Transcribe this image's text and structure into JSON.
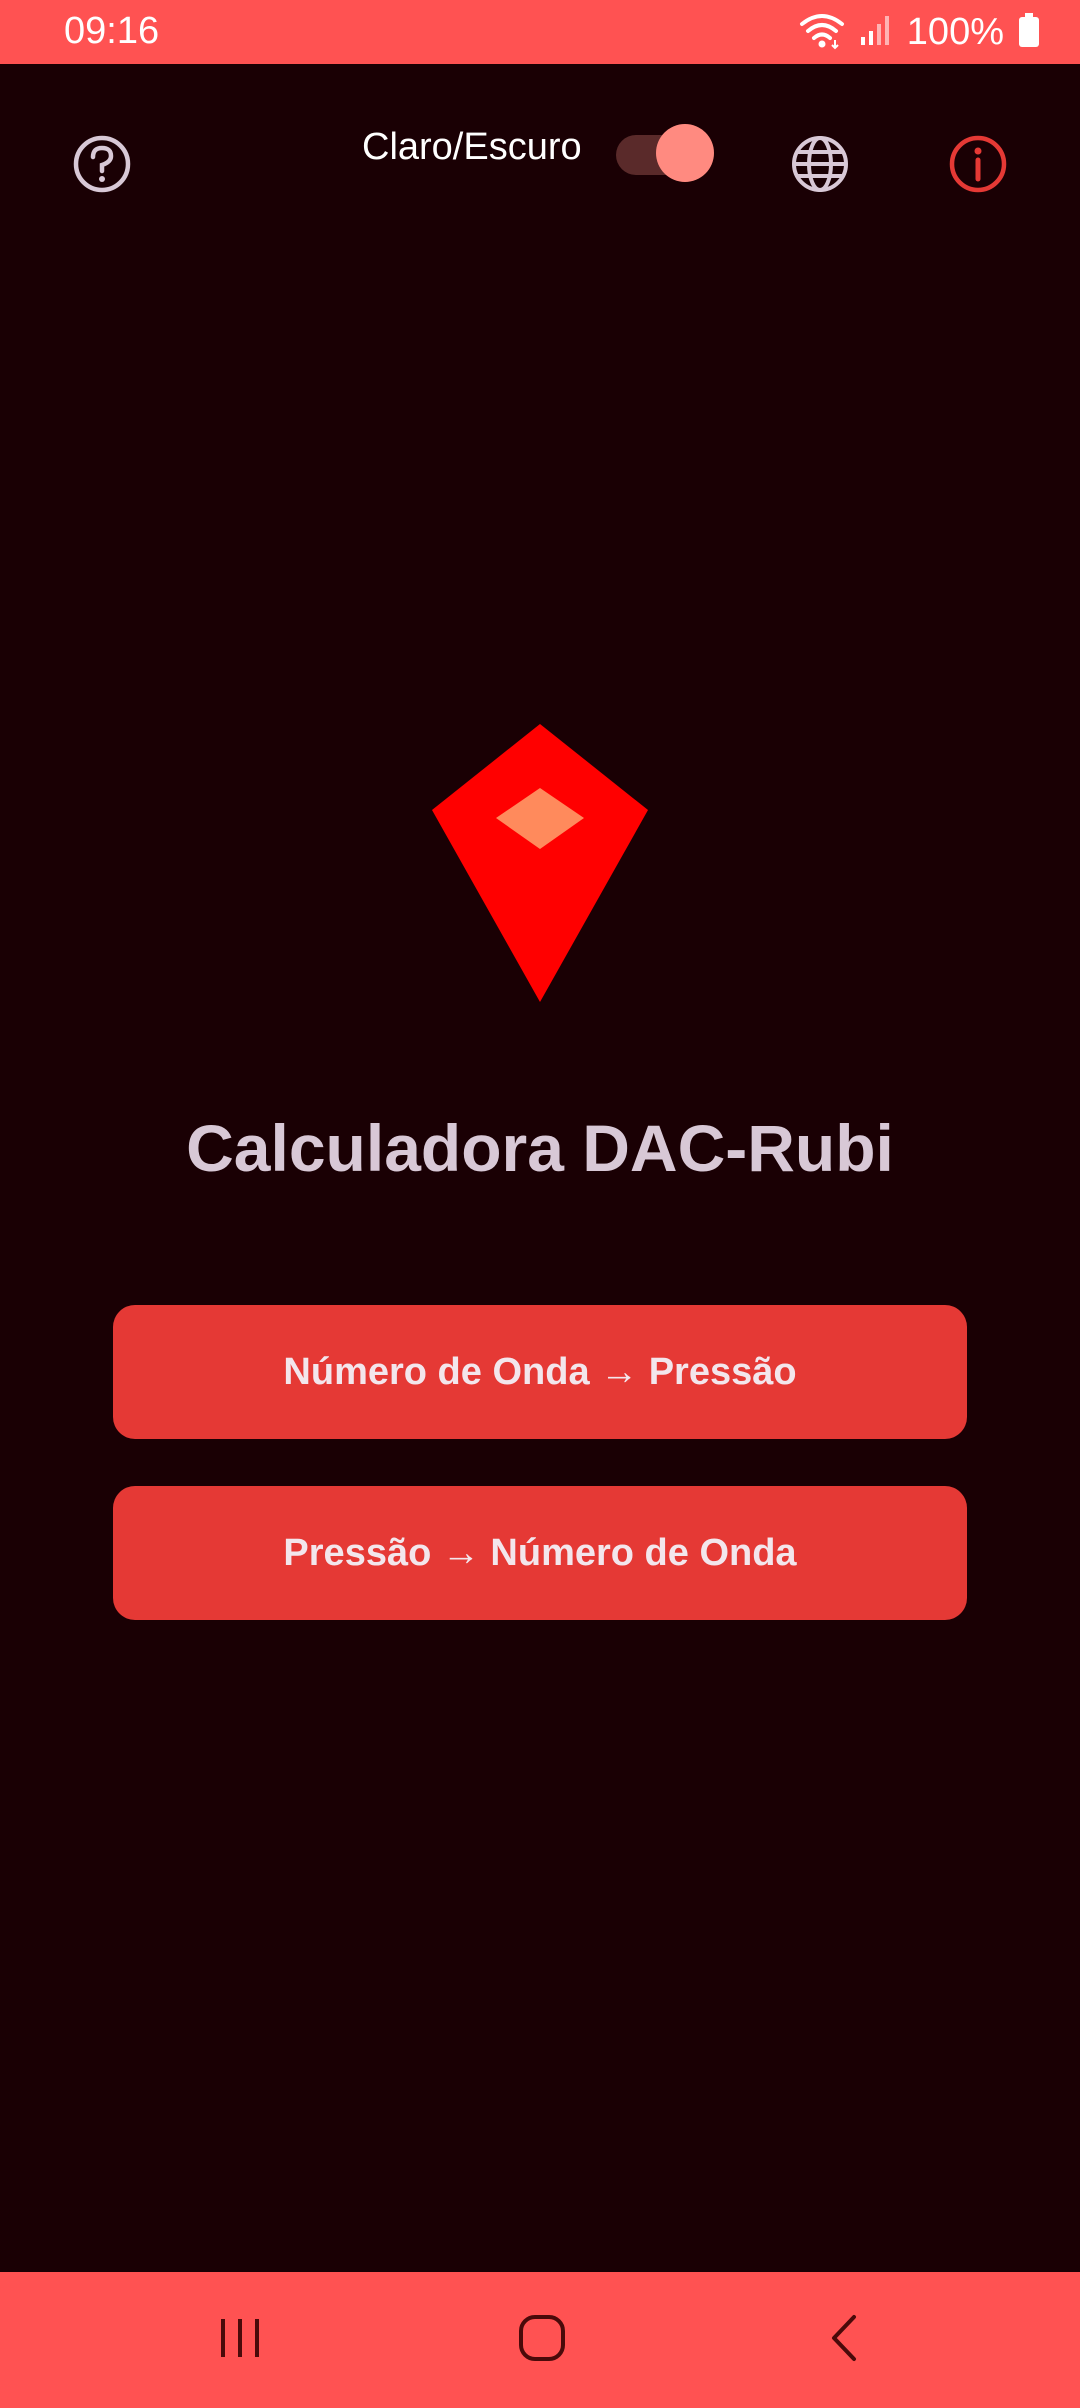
{
  "status_bar": {
    "time": "09:16",
    "battery_text": "100%",
    "icons": [
      "wifi-icon",
      "signal-icon",
      "battery-icon"
    ]
  },
  "app_bar": {
    "theme_toggle_label": "Claro/Escuro",
    "theme_toggle_on": true,
    "icons": [
      "help-icon",
      "globe-icon",
      "info-icon"
    ]
  },
  "main": {
    "title": "Calculadora DAC-Rubi",
    "buttons": [
      {
        "label": "Número de Onda → Pressão"
      },
      {
        "label": "Pressão → Número de Onda"
      }
    ]
  },
  "nav_bar": {
    "icons": [
      "recents-icon",
      "home-icon",
      "back-icon"
    ]
  },
  "colors": {
    "background": "#1a0004",
    "system_bars": "#ff5252",
    "button": "#e53935",
    "gem": "#ff0000",
    "gem_highlight": "#ff8a5c",
    "info_icon": "#e53935"
  }
}
